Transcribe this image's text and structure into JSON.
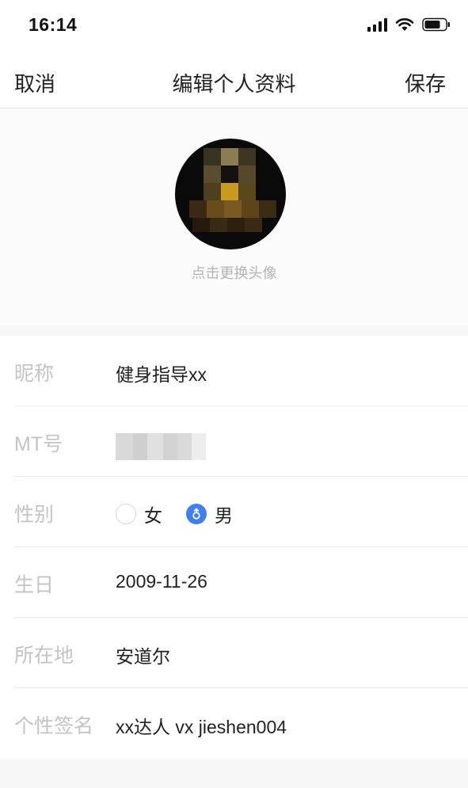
{
  "status_bar": {
    "time": "16:14"
  },
  "nav": {
    "cancel": "取消",
    "title": "编辑个人资料",
    "save": "保存"
  },
  "avatar": {
    "hint": "点击更换头像"
  },
  "form": {
    "nickname": {
      "label": "昵称",
      "value": "健身指导xx"
    },
    "mt_number": {
      "label": "MT号"
    },
    "gender": {
      "label": "性别",
      "female": "女",
      "male": "男",
      "selected": "male"
    },
    "birthday": {
      "label": "生日",
      "value": "2009-11-26"
    },
    "location": {
      "label": "所在地",
      "value": "安道尔"
    },
    "signature": {
      "label": "个性签名",
      "value": "xx达人 vx jieshen004"
    }
  },
  "colors": {
    "accent": "#3d7ff2",
    "label_gray": "#c4c4c4",
    "background": "#f7f7f8"
  }
}
